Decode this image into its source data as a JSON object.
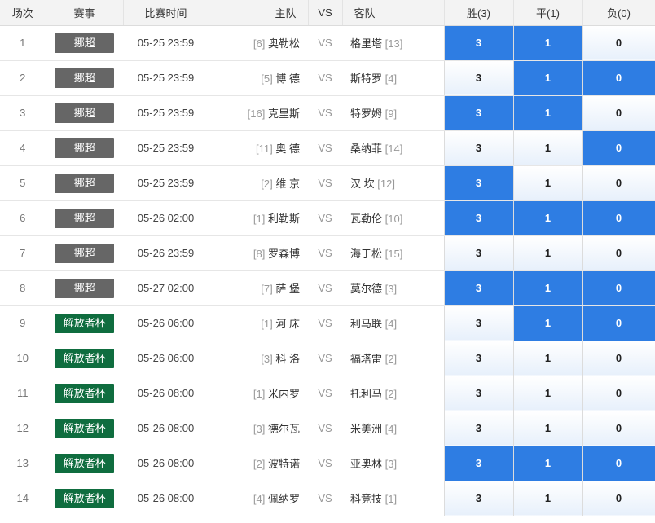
{
  "headers": {
    "idx": "场次",
    "league": "赛事",
    "time": "比赛时间",
    "home": "主队",
    "vs": "VS",
    "away": "客队",
    "win": "胜(3)",
    "draw": "平(1)",
    "lose": "负(0)"
  },
  "league_colors": {
    "挪超": "#666666",
    "解放者杯": "#0f6d3f"
  },
  "selected_color": "#2e7de3",
  "matches": [
    {
      "idx": "1",
      "league": "挪超",
      "time": "05-25 23:59",
      "home_rank": "[6]",
      "home": "奥勒松",
      "vs": "VS",
      "away": "格里塔",
      "away_rank": "[13]",
      "win": "3",
      "draw": "1",
      "lose": "0",
      "sel": [
        true,
        true,
        false
      ]
    },
    {
      "idx": "2",
      "league": "挪超",
      "time": "05-25 23:59",
      "home_rank": "[5]",
      "home": "博 德",
      "vs": "VS",
      "away": "斯特罗",
      "away_rank": "[4]",
      "win": "3",
      "draw": "1",
      "lose": "0",
      "sel": [
        false,
        true,
        true
      ]
    },
    {
      "idx": "3",
      "league": "挪超",
      "time": "05-25 23:59",
      "home_rank": "[16]",
      "home": "克里斯",
      "vs": "VS",
      "away": "特罗姆",
      "away_rank": "[9]",
      "win": "3",
      "draw": "1",
      "lose": "0",
      "sel": [
        true,
        true,
        false
      ]
    },
    {
      "idx": "4",
      "league": "挪超",
      "time": "05-25 23:59",
      "home_rank": "[11]",
      "home": "奥 德",
      "vs": "VS",
      "away": "桑纳菲",
      "away_rank": "[14]",
      "win": "3",
      "draw": "1",
      "lose": "0",
      "sel": [
        false,
        false,
        true
      ]
    },
    {
      "idx": "5",
      "league": "挪超",
      "time": "05-25 23:59",
      "home_rank": "[2]",
      "home": "维 京",
      "vs": "VS",
      "away": "汉 坎",
      "away_rank": "[12]",
      "win": "3",
      "draw": "1",
      "lose": "0",
      "sel": [
        true,
        false,
        false
      ]
    },
    {
      "idx": "6",
      "league": "挪超",
      "time": "05-26 02:00",
      "home_rank": "[1]",
      "home": "利勒斯",
      "vs": "VS",
      "away": "瓦勒伦",
      "away_rank": "[10]",
      "win": "3",
      "draw": "1",
      "lose": "0",
      "sel": [
        true,
        true,
        true
      ]
    },
    {
      "idx": "7",
      "league": "挪超",
      "time": "05-26 23:59",
      "home_rank": "[8]",
      "home": "罗森博",
      "vs": "VS",
      "away": "海于松",
      "away_rank": "[15]",
      "win": "3",
      "draw": "1",
      "lose": "0",
      "sel": [
        false,
        false,
        false
      ]
    },
    {
      "idx": "8",
      "league": "挪超",
      "time": "05-27 02:00",
      "home_rank": "[7]",
      "home": "萨 堡",
      "vs": "VS",
      "away": "莫尔德",
      "away_rank": "[3]",
      "win": "3",
      "draw": "1",
      "lose": "0",
      "sel": [
        true,
        true,
        true
      ]
    },
    {
      "idx": "9",
      "league": "解放者杯",
      "time": "05-26 06:00",
      "home_rank": "[1]",
      "home": "河 床",
      "vs": "VS",
      "away": "利马联",
      "away_rank": "[4]",
      "win": "3",
      "draw": "1",
      "lose": "0",
      "sel": [
        false,
        true,
        true
      ]
    },
    {
      "idx": "10",
      "league": "解放者杯",
      "time": "05-26 06:00",
      "home_rank": "[3]",
      "home": "科 洛",
      "vs": "VS",
      "away": "福塔雷",
      "away_rank": "[2]",
      "win": "3",
      "draw": "1",
      "lose": "0",
      "sel": [
        false,
        false,
        false
      ]
    },
    {
      "idx": "11",
      "league": "解放者杯",
      "time": "05-26 08:00",
      "home_rank": "[1]",
      "home": "米内罗",
      "vs": "VS",
      "away": "托利马",
      "away_rank": "[2]",
      "win": "3",
      "draw": "1",
      "lose": "0",
      "sel": [
        false,
        false,
        false
      ]
    },
    {
      "idx": "12",
      "league": "解放者杯",
      "time": "05-26 08:00",
      "home_rank": "[3]",
      "home": "德尔瓦",
      "vs": "VS",
      "away": "米美洲",
      "away_rank": "[4]",
      "win": "3",
      "draw": "1",
      "lose": "0",
      "sel": [
        false,
        false,
        false
      ]
    },
    {
      "idx": "13",
      "league": "解放者杯",
      "time": "05-26 08:00",
      "home_rank": "[2]",
      "home": "波特诺",
      "vs": "VS",
      "away": "亚奥林",
      "away_rank": "[3]",
      "win": "3",
      "draw": "1",
      "lose": "0",
      "sel": [
        true,
        true,
        true
      ]
    },
    {
      "idx": "14",
      "league": "解放者杯",
      "time": "05-26 08:00",
      "home_rank": "[4]",
      "home": "佩纳罗",
      "vs": "VS",
      "away": "科竞技",
      "away_rank": "[1]",
      "win": "3",
      "draw": "1",
      "lose": "0",
      "sel": [
        false,
        false,
        false
      ]
    }
  ]
}
